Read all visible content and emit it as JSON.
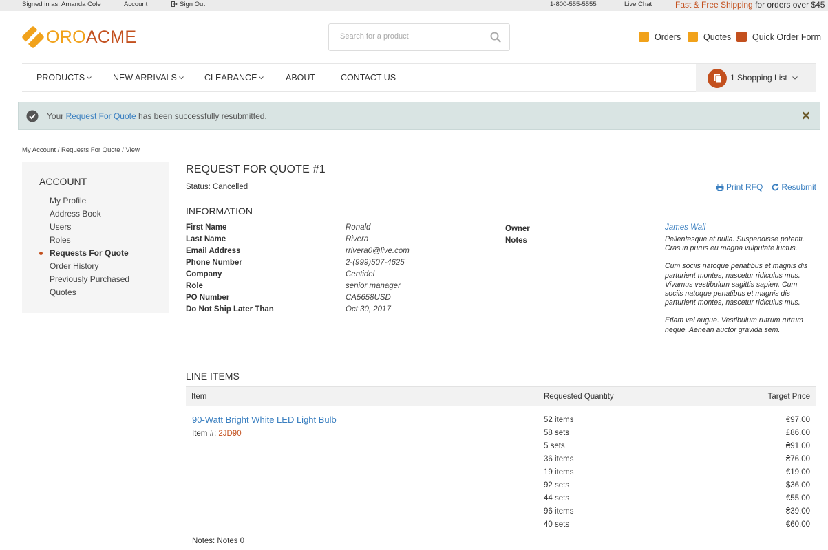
{
  "topbar": {
    "signed_in": "Signed in as: Amanda Cole",
    "account": "Account",
    "sign_out": "Sign Out",
    "phone": "1-800-555-5555",
    "live_chat": "Live Chat",
    "promo_highlight": "Fast & Free Shipping",
    "promo_rest": " for orders over $45"
  },
  "header": {
    "logo_part1": "ORO",
    "logo_part2": "ACME",
    "search_placeholder": "Search for a product",
    "orders": "Orders",
    "quotes": "Quotes",
    "quick_order": "Quick Order Form"
  },
  "nav": {
    "items": [
      "PRODUCTS",
      "NEW ARRIVALS",
      "CLEARANCE",
      "ABOUT",
      "CONTACT US"
    ],
    "shopping_list": "1 Shopping List"
  },
  "alert": {
    "prefix": "Your ",
    "link": "Request For Quote",
    "suffix": " has been successfully resubmitted."
  },
  "breadcrumb": "My Account / Requests For Quote / View",
  "sidebar": {
    "title": "ACCOUNT",
    "items": [
      "My Profile",
      "Address Book",
      "Users",
      "Roles",
      "Requests For Quote",
      "Order History",
      "Previously Purchased",
      "Quotes"
    ]
  },
  "rfq": {
    "title": "REQUEST FOR QUOTE #1",
    "status": "Status: Cancelled",
    "print": "Print RFQ",
    "resubmit": "Resubmit",
    "info_title": "INFORMATION",
    "fields": [
      {
        "label": "First Name",
        "value": "Ronald"
      },
      {
        "label": "Last Name",
        "value": "Rivera"
      },
      {
        "label": "Email Address",
        "value": "rrivera0@live.com"
      },
      {
        "label": "Phone Number",
        "value": "2-(999)507-4625"
      },
      {
        "label": "Company",
        "value": "Centidel"
      },
      {
        "label": "Role",
        "value": "senior manager"
      },
      {
        "label": "PO Number",
        "value": "CA5658USD"
      },
      {
        "label": "Do Not Ship Later Than",
        "value": "Oct 30, 2017"
      }
    ],
    "owner_label": "Owner",
    "owner_value": "James Wall",
    "notes_label": "Notes",
    "notes_paragraphs": [
      "Pellentesque at nulla. Suspendisse potenti. Cras in purus eu magna vulputate luctus.",
      "Cum sociis natoque penatibus et magnis dis parturient montes, nascetur ridiculus mus. Vivamus vestibulum sagittis sapien. Cum sociis natoque penatibus et magnis dis parturient montes, nascetur ridiculus mus.",
      "Etiam vel augue. Vestibulum rutrum rutrum neque. Aenean auctor gravida sem."
    ]
  },
  "line_items": {
    "title": "LINE ITEMS",
    "col_item": "Item",
    "col_qty": "Requested Quantity",
    "col_price": "Target Price",
    "product_name": "90-Watt Bright White LED Light Bulb",
    "sku_label": "Item #: ",
    "sku": "2JD90",
    "quantities": [
      "52 items",
      "58 sets",
      "5 sets",
      "36 items",
      "19 items",
      "92 sets",
      "44 sets",
      "96 items",
      "40 sets"
    ],
    "prices": [
      "€97.00",
      "£86.00",
      "₴91.00",
      "₴76.00",
      "€19.00",
      "$36.00",
      "€55.00",
      "₴39.00",
      "€60.00"
    ],
    "notes": "Notes: Notes 0"
  },
  "colors": {
    "accent_orange": "#c3501e",
    "logo_yellow": "#f1a21b",
    "link_blue": "#3a7fc0",
    "alert_bg": "#d9e4e3"
  }
}
